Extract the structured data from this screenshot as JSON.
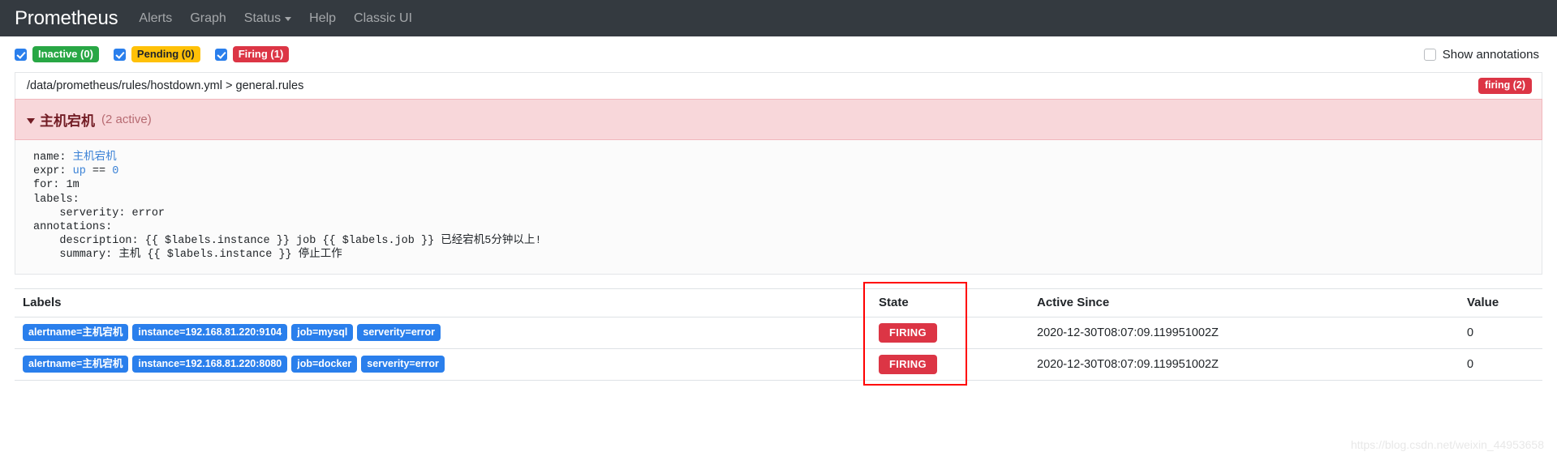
{
  "navbar": {
    "brand": "Prometheus",
    "links": [
      {
        "label": "Alerts",
        "icon": null
      },
      {
        "label": "Graph",
        "icon": null
      },
      {
        "label": "Status",
        "icon": "caret-down-icon"
      },
      {
        "label": "Help",
        "icon": null
      },
      {
        "label": "Classic UI",
        "icon": null
      }
    ]
  },
  "filters": {
    "items": [
      {
        "label": "Inactive (0)",
        "state": "inactive",
        "checked": true,
        "color": "#28a745"
      },
      {
        "label": "Pending (0)",
        "state": "pending",
        "checked": true,
        "color": "#ffc107"
      },
      {
        "label": "Firing (1)",
        "state": "firing",
        "checked": true,
        "color": "#dc3545"
      }
    ],
    "show_annotations_label": "Show annotations",
    "show_annotations_checked": false
  },
  "group": {
    "file_path": "/data/prometheus/rules/hostdown.yml > general.rules",
    "status_badge": "firing (2)",
    "alert_name": "主机宕机",
    "alert_count": "(2 active)",
    "rule": {
      "name_key": "name: ",
      "name_value": "主机宕机",
      "expr_key": "expr: ",
      "expr_metric": "up",
      "expr_operator": " == ",
      "expr_value": "0",
      "for_line": "for: 1m",
      "labels_line": "labels:",
      "labels_serverity": "    serverity: error",
      "annotations_line": "annotations:",
      "annotations_description": "    description: {{ $labels.instance }} job {{ $labels.job }} 已经宕机5分钟以上!",
      "annotations_summary": "    summary: 主机 {{ $labels.instance }} 停止工作"
    }
  },
  "table": {
    "headers": [
      "Labels",
      "State",
      "Active Since",
      "Value"
    ],
    "rows": [
      {
        "labels": [
          "alertname=主机宕机",
          "instance=192.168.81.220:9104",
          "job=mysql",
          "serverity=error"
        ],
        "state": "FIRING",
        "active_since": "2020-12-30T08:07:09.119951002Z",
        "value": "0"
      },
      {
        "labels": [
          "alertname=主机宕机",
          "instance=192.168.81.220:8080",
          "job=docker",
          "serverity=error"
        ],
        "state": "FIRING",
        "active_since": "2020-12-30T08:07:09.119951002Z",
        "value": "0"
      }
    ]
  },
  "watermark": "https://blog.csdn.net/weixin_44953658",
  "colors": {
    "navbar_bg": "#343a40",
    "accent_blue": "#2a7fec",
    "firing_red": "#dc3545",
    "inactive_green": "#28a745",
    "pending_yellow": "#ffc107",
    "alert_panel_bg": "#f8d7da",
    "highlight_box": "#ff0000"
  }
}
